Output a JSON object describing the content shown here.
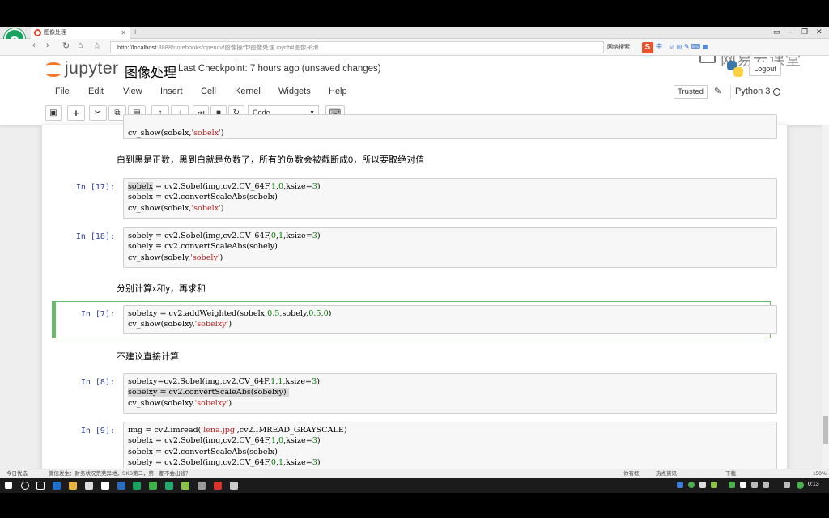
{
  "browser": {
    "tab_title": "图像处理",
    "url_host": "http://localhost",
    "url_rest": ":8888/notebooks/opencv/图像操作/图像处理.ipynb#图像平滑",
    "search_hint": "网络搜索",
    "status_left": "今日优选",
    "status_news": "微信发生：财务状况荒芜异地，SKS第二，第一都不会出钱？",
    "status_right_a": "你有框",
    "status_right_b": "热点资讯",
    "status_download": "下载",
    "status_zoom": "150%",
    "clock": "0:13"
  },
  "jupyter": {
    "logo_text": "jupyter",
    "notebook_title": "图像处理",
    "checkpoint": "Last Checkpoint: 7 hours ago (unsaved changes)",
    "logout": "Logout",
    "watermark": "网易云课堂",
    "menu": [
      "File",
      "Edit",
      "View",
      "Insert",
      "Cell",
      "Kernel",
      "Widgets",
      "Help"
    ],
    "trusted": "Trusted",
    "kernel_name": "Python 3",
    "cell_type": "Code"
  },
  "cells": {
    "top_fragment": "cv_show(sobelx,'sobelx')",
    "md1": "白到黑是正数，黑到白就是负数了，所有的负数会被截断成0，所以要取绝对值",
    "c17_prompt": "In [17]:",
    "c18_prompt": "In [18]:",
    "md2": "分别计算x和y，再求和",
    "c7_prompt": "In [7]:",
    "md3": "不建议直接计算",
    "c8_prompt": "In [8]:",
    "c9_prompt": "In [9]:"
  }
}
